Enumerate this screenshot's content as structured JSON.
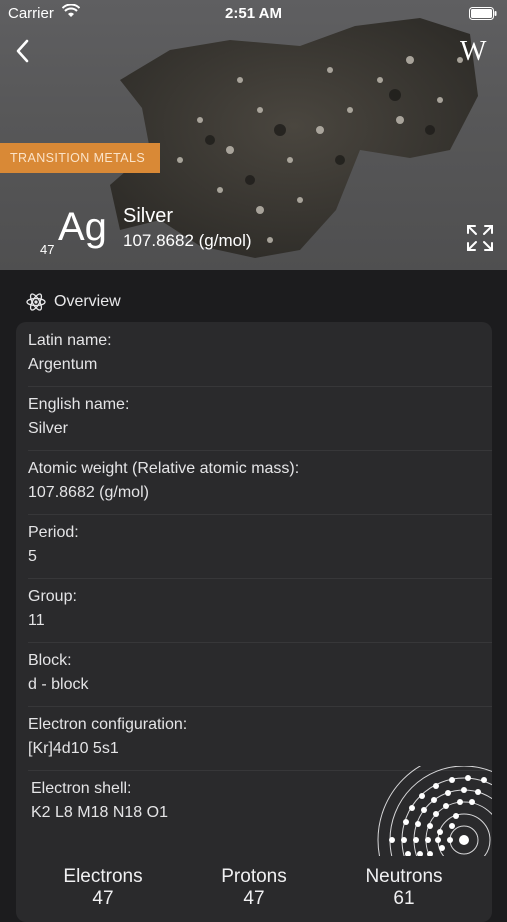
{
  "status_bar": {
    "carrier": "Carrier",
    "time": "2:51 AM"
  },
  "header": {
    "wiki_label": "W"
  },
  "element": {
    "category": "TRANSITION METALS",
    "atomic_number": "47",
    "symbol": "Ag",
    "name": "Silver",
    "mass": "107.8682 (g/mol)"
  },
  "section": {
    "title": "Overview"
  },
  "rows": [
    {
      "label": "Latin name:",
      "value": "Argentum"
    },
    {
      "label": "English name:",
      "value": "Silver"
    },
    {
      "label": "Atomic weight (Relative atomic mass):",
      "value": "107.8682 (g/mol)"
    },
    {
      "label": "Period:",
      "value": "5"
    },
    {
      "label": "Group:",
      "value": "11"
    },
    {
      "label": "Block:",
      "value": "d - block"
    },
    {
      "label": "Electron configuration:",
      "value": "[Kr]4d10 5s1"
    },
    {
      "label": "Electron shell:",
      "value": "K2 L8 M18 N18 O1"
    }
  ],
  "counts": [
    {
      "label": "Electrons",
      "value": "47"
    },
    {
      "label": "Protons",
      "value": "47"
    },
    {
      "label": "Neutrons",
      "value": "61"
    }
  ],
  "colors": {
    "category_bg": "#d98936",
    "card_bg": "#2a2a2c",
    "page_bg": "#1c1c1e"
  }
}
